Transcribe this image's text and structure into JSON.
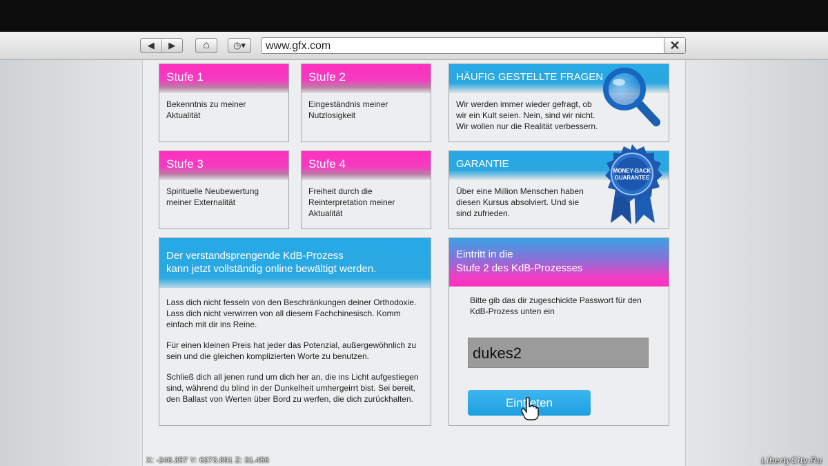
{
  "browser": {
    "url": "www.gfx.com",
    "back_label": "◀",
    "forward_label": "▶",
    "home_label": "⌂",
    "history_label": "◷▾",
    "clear_label": "✕"
  },
  "steps": [
    {
      "title": "Stufe 1",
      "text": "Bekenntnis zu meiner Aktualität"
    },
    {
      "title": "Stufe 2",
      "text": "Eingeständnis meiner Nutzlosigkeit"
    },
    {
      "title": "Stufe 3",
      "text": "Spirituelle Neubewertung meiner Externalität"
    },
    {
      "title": "Stufe 4",
      "text": "Freiheit durch die Reinterpretation meiner Aktualität"
    }
  ],
  "faq": {
    "title": "HÄUFIG GESTELLTE FRAGEN",
    "text": "Wir werden immer wieder gefragt, ob wir ein Kult seien. Nein, sind wir nicht. Wir wollen nur die Realität verbessern."
  },
  "guarantee": {
    "title": "GARANTIE",
    "text": "Über eine Million Menschen haben diesen Kursus absolviert. Und sie sind zufrieden.",
    "badge_line1": "MONEY-BACK",
    "badge_line2": "GUARANTEE"
  },
  "banner": {
    "title_line1": "Der verstandsprengende KdB-Prozess",
    "title_line2": "kann jetzt vollständig online bewältigt werden.",
    "paragraphs": [
      "Lass dich nicht fesseln von den Beschränkungen deiner Orthodoxie. Lass dich nicht verwirren von all diesem Fachchinesisch. Komm einfach mit dir ins Reine.",
      "Für einen kleinen Preis hat jeder das Potenzial, außergewöhnlich zu sein und die gleichen komplizierten Worte zu benutzen.",
      "Schließ dich all jenen rund um dich her an, die ins Licht aufgestiegen sind, während du blind in der Dunkelheit umhergeirrt bist. Sei bereit, den Ballast von Werten über Bord zu werfen, die dich zurückhalten."
    ]
  },
  "entry": {
    "title_line1": "Eintritt in die",
    "title_line2": "Stufe 2 des KdB-Prozesses",
    "prompt": "Bitte gib das dir zugeschickte Passwort für den KdB-Prozess unten ein",
    "password_value": "dukes2",
    "button_label": "Eintreten"
  },
  "hud": {
    "coords": "X: -246.357 Y: 6273.891 Z: 31.456",
    "watermark": "LibertyCity.Ru"
  },
  "colors": {
    "pink": "#ff2fc0",
    "blue": "#26a9e6",
    "page_bg": "#eceeef"
  }
}
